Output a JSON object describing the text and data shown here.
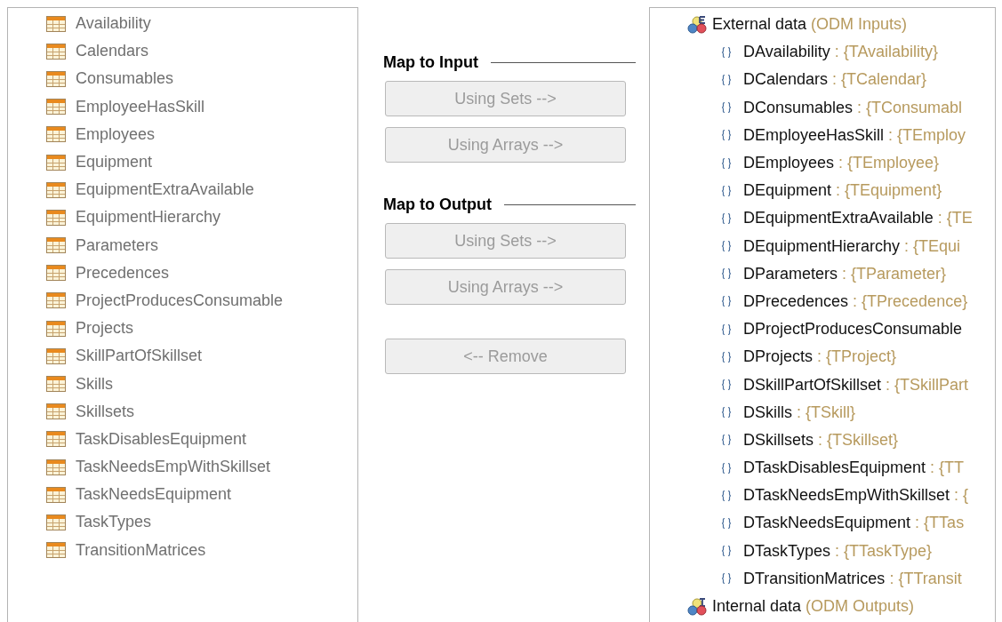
{
  "tables": [
    {
      "label": "Availability"
    },
    {
      "label": "Calendars"
    },
    {
      "label": "Consumables"
    },
    {
      "label": "EmployeeHasSkill"
    },
    {
      "label": "Employees"
    },
    {
      "label": "Equipment"
    },
    {
      "label": "EquipmentExtraAvailable"
    },
    {
      "label": "EquipmentHierarchy"
    },
    {
      "label": "Parameters"
    },
    {
      "label": "Precedences"
    },
    {
      "label": "ProjectProducesConsumable"
    },
    {
      "label": "Projects"
    },
    {
      "label": "SkillPartOfSkillset"
    },
    {
      "label": "Skills"
    },
    {
      "label": "Skillsets"
    },
    {
      "label": "TaskDisablesEquipment"
    },
    {
      "label": "TaskNeedsEmpWithSkillset"
    },
    {
      "label": "TaskNeedsEquipment"
    },
    {
      "label": "TaskTypes"
    },
    {
      "label": "TransitionMatrices"
    }
  ],
  "mapping": {
    "sections": [
      {
        "heading": "Map to Input",
        "buttons": [
          {
            "label": "Using Sets -->",
            "disabled": true
          },
          {
            "label": "Using Arrays -->",
            "disabled": true
          }
        ]
      },
      {
        "heading": "Map to Output",
        "buttons": [
          {
            "label": "Using Sets -->",
            "disabled": true
          },
          {
            "label": "Using Arrays -->",
            "disabled": true
          }
        ]
      }
    ],
    "remove_button": {
      "label": "<-- Remove",
      "disabled": true
    }
  },
  "data_tree": [
    {
      "label": "External data",
      "note": "(ODM Inputs)",
      "kind": "external",
      "children": [
        {
          "name": "DAvailability",
          "type": ": {TAvailability}"
        },
        {
          "name": "DCalendars",
          "type": ": {TCalendar}"
        },
        {
          "name": "DConsumables",
          "type": ": {TConsumabl"
        },
        {
          "name": "DEmployeeHasSkill",
          "type": ": {TEmploy"
        },
        {
          "name": "DEmployees",
          "type": ": {TEmployee}"
        },
        {
          "name": "DEquipment",
          "type": ": {TEquipment}"
        },
        {
          "name": "DEquipmentExtraAvailable",
          "type": ": {TE"
        },
        {
          "name": "DEquipmentHierarchy",
          "type": ": {TEqui"
        },
        {
          "name": "DParameters",
          "type": ": {TParameter}"
        },
        {
          "name": "DPrecedences",
          "type": ": {TPrecedence}"
        },
        {
          "name": "DProjectProducesConsumable"
        },
        {
          "name": "DProjects",
          "type": ": {TProject}"
        },
        {
          "name": "DSkillPartOfSkillset",
          "type": ": {TSkillPart"
        },
        {
          "name": "DSkills",
          "type": ": {TSkill}"
        },
        {
          "name": "DSkillsets",
          "type": ": {TSkillset}"
        },
        {
          "name": "DTaskDisablesEquipment",
          "type": ": {TT"
        },
        {
          "name": "DTaskNeedsEmpWithSkillset",
          "type": ": {"
        },
        {
          "name": "DTaskNeedsEquipment",
          "type": ": {TTas"
        },
        {
          "name": "DTaskTypes",
          "type": ": {TTaskType}"
        },
        {
          "name": "DTransitionMatrices",
          "type": ": {TTransit"
        }
      ]
    },
    {
      "label": "Internal data",
      "note": "(ODM Outputs)",
      "kind": "internal"
    }
  ]
}
